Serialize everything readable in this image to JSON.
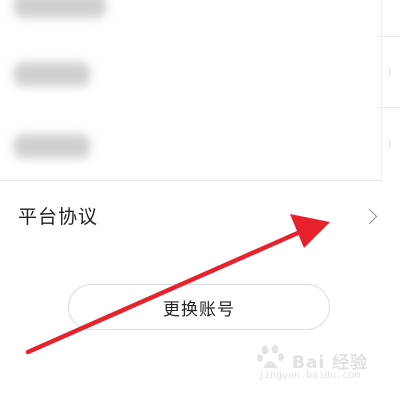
{
  "settings": {
    "items": [
      {
        "label": "",
        "redacted": true
      },
      {
        "label": "",
        "redacted": true
      },
      {
        "label": "",
        "redacted": true
      },
      {
        "label": "平台协议",
        "redacted": false
      }
    ],
    "switch_account_label": "更换账号"
  },
  "watermark": {
    "main": "Bai 经验",
    "sub": "jingyan.baidu.com"
  },
  "annotation": {
    "arrow_color": "#e8222c"
  }
}
